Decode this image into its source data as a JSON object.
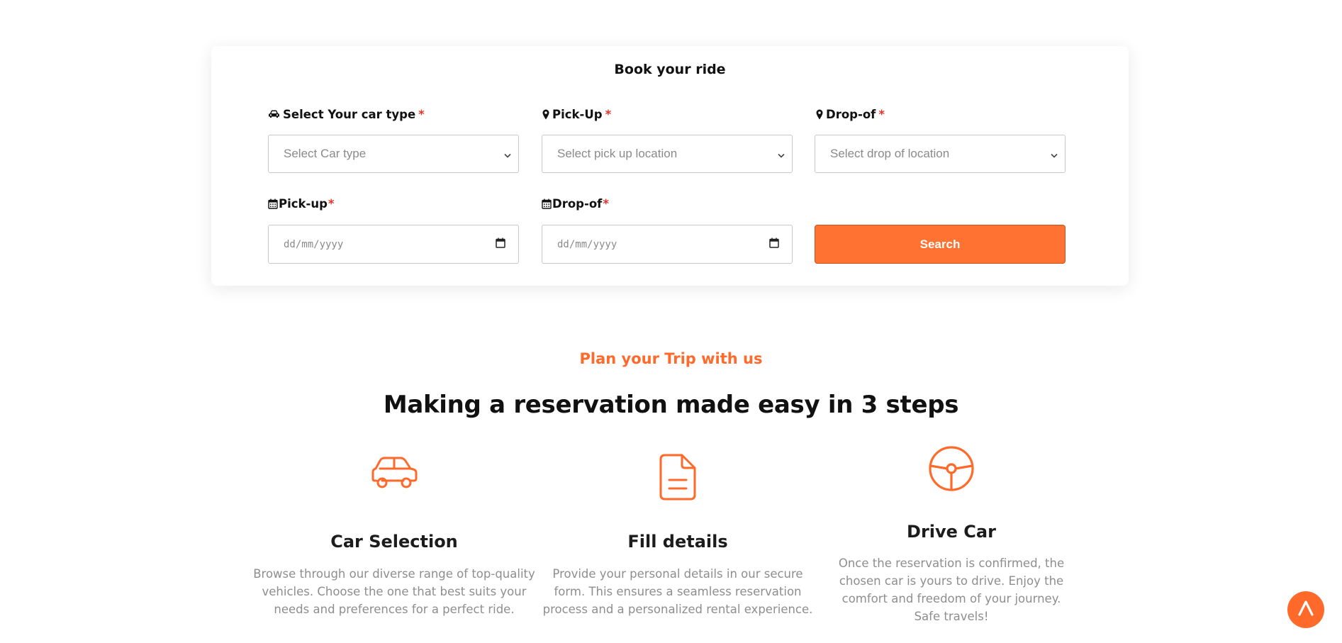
{
  "booking": {
    "title": "Book your ride",
    "required_mark": "*",
    "car_type": {
      "label": "Select Your car type",
      "placeholder": "Select Car type",
      "icon": "car-icon"
    },
    "pickup_location": {
      "label": "Pick-Up",
      "placeholder": "Select pick up location",
      "icon": "location-pin-icon"
    },
    "dropoff_location": {
      "label": "Drop-of",
      "placeholder": "Select drop of location",
      "icon": "location-pin-icon"
    },
    "pickup_date": {
      "label": "Pick-up",
      "placeholder": "dd/mm/yyyy",
      "icon": "calendar-icon"
    },
    "dropoff_date": {
      "label": "Drop-of",
      "placeholder": "dd/mm/yyyy",
      "icon": "calendar-icon"
    },
    "search_label": "Search"
  },
  "plan": {
    "eyebrow": "Plan your Trip with us",
    "headline": "Making a reservation made easy in 3 steps",
    "steps": [
      {
        "icon": "car-outline-icon",
        "title": "Car Selection",
        "text": "Browse through our diverse range of top-quality vehicles. Choose the one that best suits your needs and preferences for a perfect ride."
      },
      {
        "icon": "document-icon",
        "title": "Fill details",
        "text": "Provide your personal details in our secure form. This ensures a seamless reservation process and a personalized rental experience."
      },
      {
        "icon": "steering-wheel-icon",
        "title": "Drive Car",
        "text": "Once the reservation is confirmed, the chosen car is yours to drive. Enjoy the comfort and freedom of your journey. Safe travels!"
      }
    ]
  },
  "colors": {
    "accent": "#ff6a2b",
    "button": "#ff7231",
    "required": "#e5322b",
    "muted_text": "#8e8e8e"
  },
  "scroll_top_icon": "chevron-up-icon"
}
